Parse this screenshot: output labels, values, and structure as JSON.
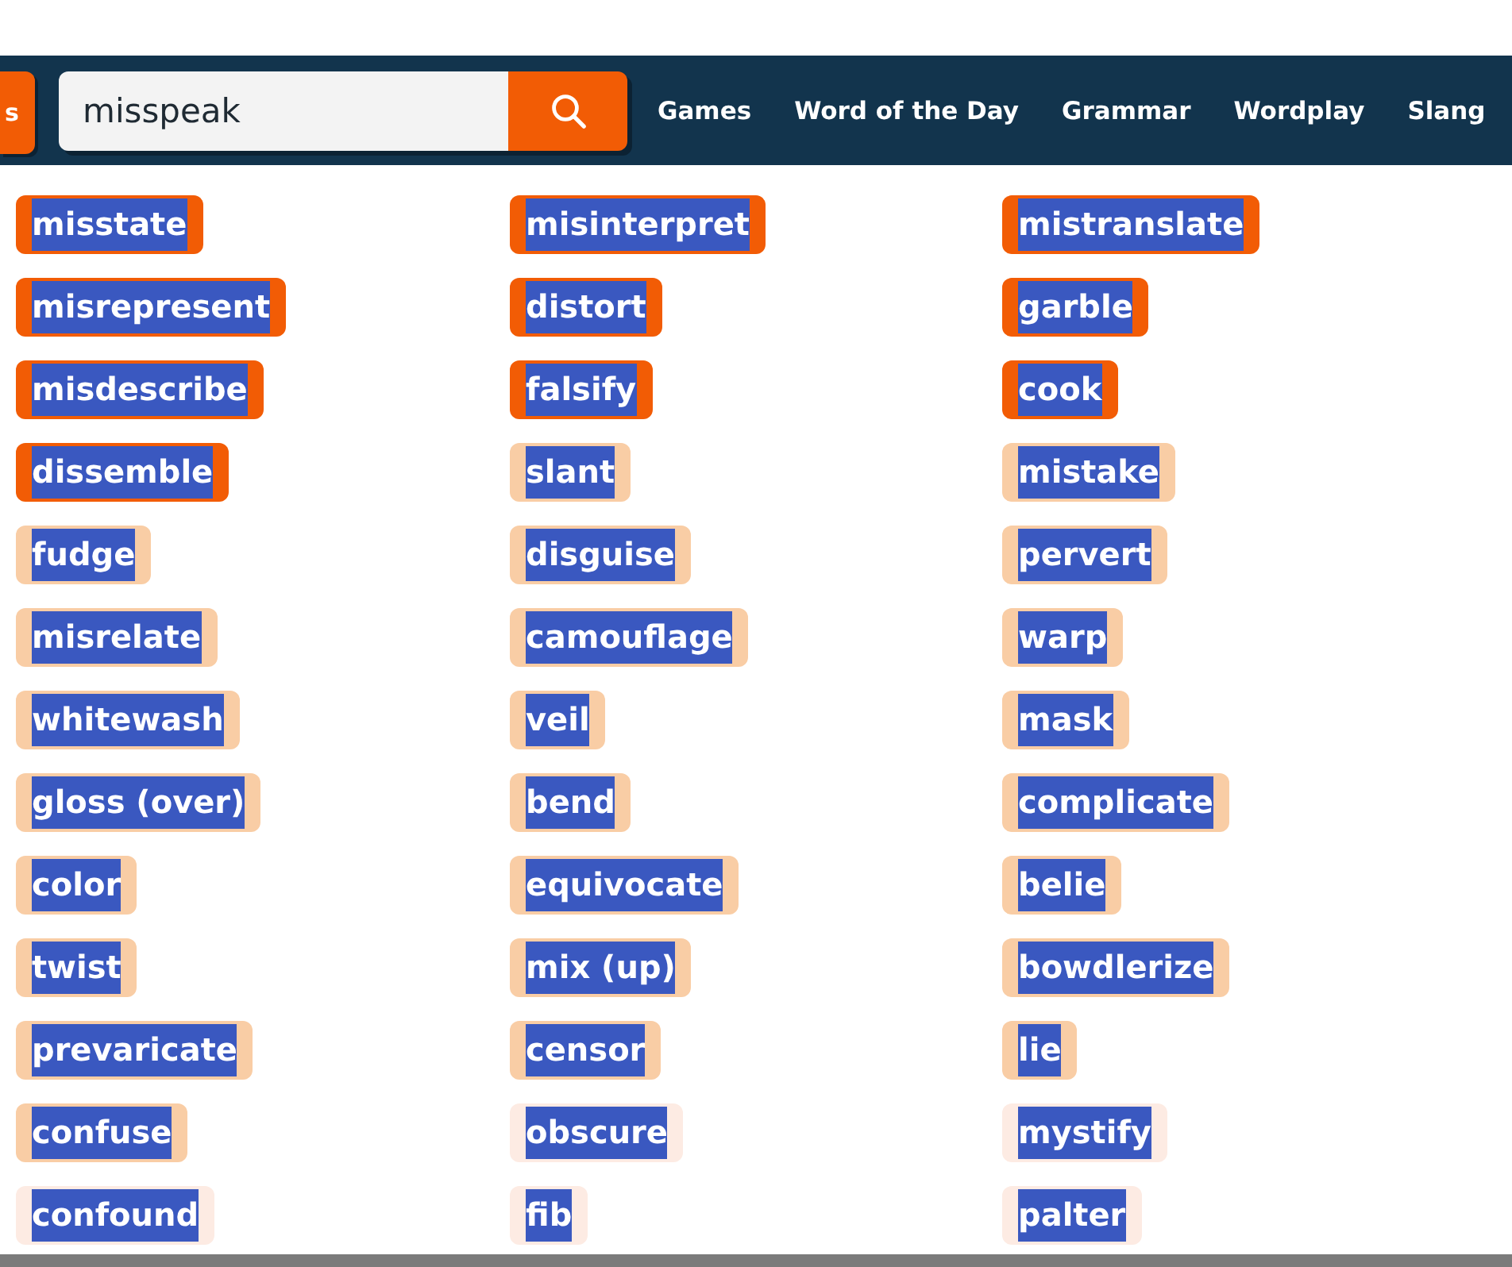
{
  "header": {
    "edge_button": {
      "label": "s"
    },
    "search": {
      "value": "misspeak"
    },
    "nav_links": [
      "Games",
      "Word of the Day",
      "Grammar",
      "Wordplay",
      "Slang"
    ]
  },
  "words": [
    {
      "text": "misstate",
      "color": "#f25c05",
      "highlighted": true
    },
    {
      "text": "misinterpret",
      "color": "#f25c05",
      "highlighted": true
    },
    {
      "text": "mistranslate",
      "color": "#f25c05",
      "highlighted": true
    },
    {
      "text": "misrepresent",
      "color": "#f25c05",
      "highlighted": true
    },
    {
      "text": "distort",
      "color": "#f25c05",
      "highlighted": true
    },
    {
      "text": "garble",
      "color": "#f25c05",
      "highlighted": true
    },
    {
      "text": "misdescribe",
      "color": "#f25c05",
      "highlighted": true
    },
    {
      "text": "falsify",
      "color": "#f25c05",
      "highlighted": true
    },
    {
      "text": "cook",
      "color": "#f25c05",
      "highlighted": true
    },
    {
      "text": "dissemble",
      "color": "#f25c05",
      "highlighted": true
    },
    {
      "text": "slant",
      "color": "#f9cda5",
      "highlighted": true
    },
    {
      "text": "mistake",
      "color": "#f9cda5",
      "highlighted": true
    },
    {
      "text": "fudge",
      "color": "#f9cda5",
      "highlighted": true
    },
    {
      "text": "disguise",
      "color": "#f9cda5",
      "highlighted": true
    },
    {
      "text": "pervert",
      "color": "#f9cda5",
      "highlighted": true
    },
    {
      "text": "misrelate",
      "color": "#f9cda5",
      "highlighted": true
    },
    {
      "text": "camouflage",
      "color": "#f9cda5",
      "highlighted": true
    },
    {
      "text": "warp",
      "color": "#f9cda5",
      "highlighted": true
    },
    {
      "text": "whitewash",
      "color": "#f9cda5",
      "highlighted": true
    },
    {
      "text": "veil",
      "color": "#f9cda5",
      "highlighted": true
    },
    {
      "text": "mask",
      "color": "#f9cda5",
      "highlighted": true
    },
    {
      "text": "gloss (over)",
      "color": "#f9cda5",
      "highlighted": true
    },
    {
      "text": "bend",
      "color": "#f9cda5",
      "highlighted": true
    },
    {
      "text": "complicate",
      "color": "#f9cda5",
      "highlighted": true
    },
    {
      "text": "color",
      "color": "#f9cda5",
      "highlighted": true
    },
    {
      "text": "equivocate",
      "color": "#f9cda5",
      "highlighted": true
    },
    {
      "text": "belie",
      "color": "#f9cda5",
      "highlighted": true
    },
    {
      "text": "twist",
      "color": "#f9cda5",
      "highlighted": true
    },
    {
      "text": "mix (up)",
      "color": "#f9cda5",
      "highlighted": true
    },
    {
      "text": "bowdlerize",
      "color": "#f9cda5",
      "highlighted": true
    },
    {
      "text": "prevaricate",
      "color": "#f9cda5",
      "highlighted": true
    },
    {
      "text": "censor",
      "color": "#f9cda5",
      "highlighted": true
    },
    {
      "text": "lie",
      "color": "#f9cda5",
      "highlighted": true
    },
    {
      "text": "confuse",
      "color": "#f9cda5",
      "highlighted": true
    },
    {
      "text": "obscure",
      "color": "#fdebe3",
      "highlighted": true
    },
    {
      "text": "mystify",
      "color": "#fdebe3",
      "highlighted": true
    },
    {
      "text": "confound",
      "color": "#fdebe3",
      "highlighted": true
    },
    {
      "text": "fib",
      "color": "#fdebe3",
      "highlighted": true
    },
    {
      "text": "palter",
      "color": "#fdebe3",
      "highlighted": true
    }
  ]
}
